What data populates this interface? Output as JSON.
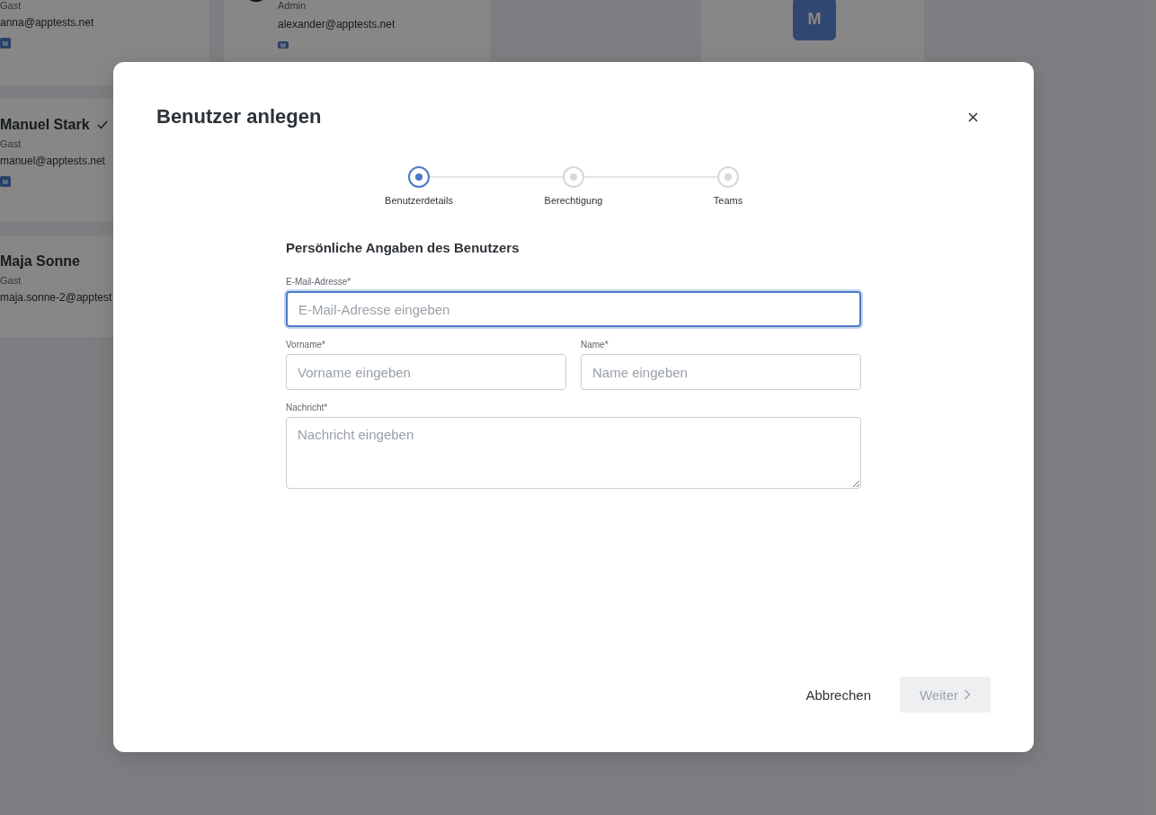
{
  "background": {
    "columns": [
      {
        "cards": [
          {
            "kind": "person",
            "role": "Gast",
            "email": "anna@apptests.net",
            "badge": "M"
          },
          {
            "kind": "person",
            "name": "Manuel Stark",
            "verified": true,
            "role": "Gast",
            "email": "manuel@apptests.net",
            "badge": "M"
          },
          {
            "kind": "person",
            "name": "Maja Sonne",
            "verified": false,
            "role": "Gast",
            "email": "maja.sonne-2@apptest"
          }
        ]
      },
      {
        "cards": [
          {
            "role": "Admin",
            "email": "alexander@apptests.net",
            "badge": "M"
          }
        ]
      },
      {
        "cards": [
          {
            "kind": "initial",
            "initial": "M"
          }
        ]
      }
    ]
  },
  "dialog": {
    "title": "Benutzer anlegen",
    "steps": [
      {
        "label": "Benutzerdetails",
        "selected": true
      },
      {
        "label": "Berechtigung",
        "selected": false
      },
      {
        "label": "Teams",
        "selected": false
      }
    ],
    "section_title": "Persönliche Angaben des Benutzers",
    "fields": [
      {
        "kind": "input",
        "label": "E-Mail-Adresse*",
        "placeholder": "E-Mail-Adresse eingeben",
        "focused": true
      },
      {
        "kind": "input",
        "label": "Vorname*",
        "placeholder": "Vorname eingeben",
        "focused": false
      },
      {
        "kind": "input",
        "label": "Name*",
        "placeholder": "Name eingeben",
        "focused": false
      },
      {
        "kind": "textarea",
        "label": "Nachricht*",
        "placeholder": "Nachricht eingeben",
        "focused": false
      }
    ],
    "cancel": "Abbrechen",
    "next": {
      "label": "Weiter",
      "disabled": true
    }
  }
}
